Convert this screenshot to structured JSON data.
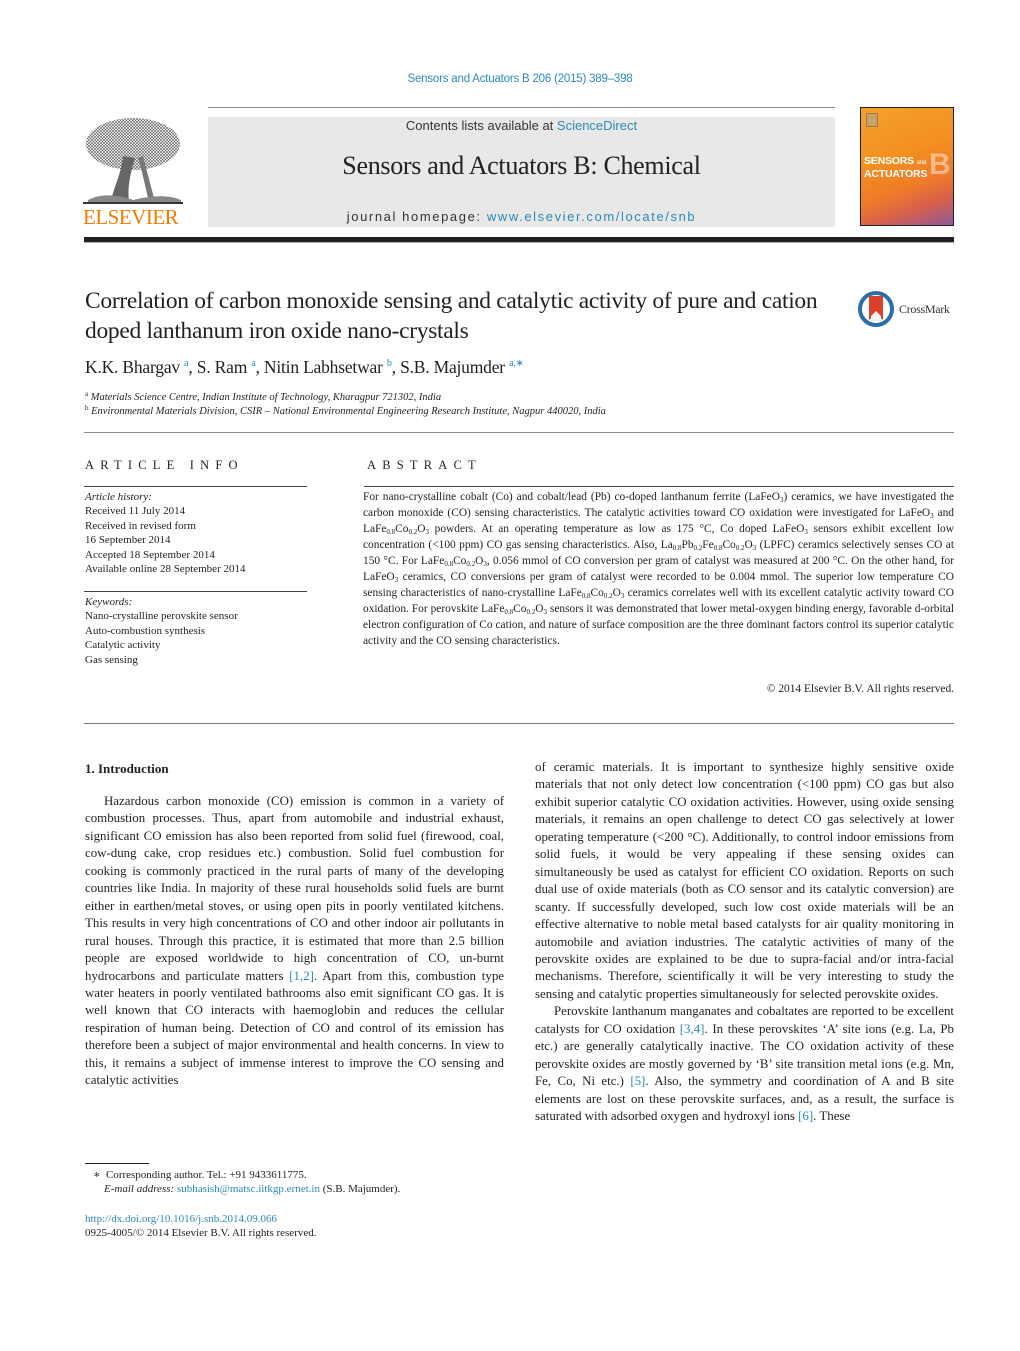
{
  "header": {
    "citation": "Sensors and Actuators B 206 (2015) 389–398",
    "contents_prefix": "Contents lists available at ",
    "contents_link": "ScienceDirect",
    "journal_title": "Sensors and Actuators B: Chemical",
    "homepage_prefix": "journal homepage: ",
    "homepage_link": "www.elsevier.com/locate/snb",
    "publisher_logo_text": "ELSEVIER",
    "cover": {
      "line1": "SENSORS",
      "and": "and",
      "line2": "ACTUATORS",
      "letter": "B"
    },
    "colors": {
      "link": "#2a8ab8",
      "elsevier_orange": "#f07c00",
      "masthead_bg": "#e8e8e8"
    }
  },
  "article": {
    "title": "Correlation of carbon monoxide sensing and catalytic activity of pure and cation doped lanthanum iron oxide nano-crystals",
    "crossmark_label": "CrossMark",
    "authors": [
      {
        "name": "K.K. Bhargav",
        "sup": "a"
      },
      {
        "name": "S. Ram",
        "sup": "a"
      },
      {
        "name": "Nitin Labhsetwar",
        "sup": "b"
      },
      {
        "name": "S.B. Majumder",
        "sup": "a,∗"
      }
    ],
    "affiliations": [
      {
        "sup": "a",
        "text": "Materials Science Centre, Indian Institute of Technology, Kharagpur 721302, India"
      },
      {
        "sup": "b",
        "text": "Environmental Materials Division, CSIR – National Environmental Engineering Research Institute, Nagpur 440020, India"
      }
    ]
  },
  "article_info": {
    "heading": "ARTICLE INFO",
    "history_label": "Article history:",
    "history": [
      "Received 11 July 2014",
      "Received in revised form",
      "16 September 2014",
      "Accepted 18 September 2014",
      "Available online 28 September 2014"
    ],
    "keywords_label": "Keywords:",
    "keywords": [
      "Nano-crystalline perovskite sensor",
      "Auto-combustion synthesis",
      "Catalytic activity",
      "Gas sensing"
    ]
  },
  "abstract": {
    "heading": "ABSTRACT",
    "segments": [
      {
        "t": "For nano-crystalline cobalt (Co) and cobalt/lead (Pb) co-doped lanthanum ferrite (LaFeO"
      },
      {
        "s": "3"
      },
      {
        "t": ") ceramics, we have investigated the carbon monoxide (CO) sensing characteristics. The catalytic activities toward CO oxidation were investigated for LaFeO"
      },
      {
        "s": "3"
      },
      {
        "t": " and LaFe"
      },
      {
        "s": "0.8"
      },
      {
        "t": "Co"
      },
      {
        "s": "0.2"
      },
      {
        "t": "O"
      },
      {
        "s": "3"
      },
      {
        "t": " powders. At an operating temperature as low as 175 °C, Co doped LaFeO"
      },
      {
        "s": "3"
      },
      {
        "t": " sensors exhibit excellent low concentration (<100 ppm) CO gas sensing characteristics. Also, La"
      },
      {
        "s": "0.8"
      },
      {
        "t": "Pb"
      },
      {
        "s": "0.2"
      },
      {
        "t": "Fe"
      },
      {
        "s": "0.8"
      },
      {
        "t": "Co"
      },
      {
        "s": "0.2"
      },
      {
        "t": "O"
      },
      {
        "s": "3"
      },
      {
        "t": " (LPFC) ceramics selectively senses CO at 150 °C. For LaFe"
      },
      {
        "s": "0.8"
      },
      {
        "t": "Co"
      },
      {
        "s": "0.2"
      },
      {
        "t": "O"
      },
      {
        "s": "3"
      },
      {
        "t": ", 0.056 mmol of CO conversion per gram of catalyst was measured at 200 °C. On the other hand, for LaFeO"
      },
      {
        "s": "3"
      },
      {
        "t": " ceramics, CO conversions per gram of catalyst were recorded to be 0.004 mmol. The superior low temperature CO sensing characteristics of nano-crystalline LaFe"
      },
      {
        "s": "0.8"
      },
      {
        "t": "Co"
      },
      {
        "s": "0.2"
      },
      {
        "t": "O"
      },
      {
        "s": "3"
      },
      {
        "t": " ceramics correlates well with its excellent catalytic activity toward CO oxidation. For perovskite LaFe"
      },
      {
        "s": "0.8"
      },
      {
        "t": "Co"
      },
      {
        "s": "0.2"
      },
      {
        "t": "O"
      },
      {
        "s": "3"
      },
      {
        "t": " sensors it was demonstrated that lower metal-oxygen binding energy, favorable d-orbital electron configuration of Co cation, and nature of surface composition are the three dominant factors control its superior catalytic activity and the CO sensing characteristics."
      }
    ],
    "copyright": "© 2014 Elsevier B.V. All rights reserved."
  },
  "body": {
    "section_heading": "1.  Introduction",
    "col1_para1": [
      {
        "t": "Hazardous carbon monoxide (CO) emission is common in a variety of combustion processes. Thus, apart from automobile and industrial exhaust, significant CO emission has also been reported from solid fuel (firewood, coal, cow-dung cake, crop residues etc.) combustion. Solid fuel combustion for cooking is commonly practiced in the rural parts of many of the developing countries like India. In majority of these rural households solid fuels are burnt either in earthen/metal stoves, or using open pits in poorly ventilated kitchens. This results in very high concentrations of CO and other indoor air pollutants in rural houses. Through this practice, it is estimated that more than 2.5 billion people are exposed worldwide to high concentration of CO, un-burnt hydrocarbons and particulate matters "
      },
      {
        "r": "[1,2]"
      },
      {
        "t": ". Apart from this, combustion type water heaters in poorly ventilated bathrooms also emit significant CO gas. It is well known that CO interacts with haemoglobin and reduces the cellular respiration of human being. Detection of CO and control of its emission has therefore been a subject of major environmental and health concerns. In view to this, it remains a subject of immense interest to improve the CO sensing and catalytic activities"
      }
    ],
    "col2_para1": [
      {
        "t": "of ceramic materials. It is important to synthesize highly sensitive oxide materials that not only detect low concentration (<100 ppm) CO gas but also exhibit superior catalytic CO oxidation activities. However, using oxide sensing materials, it remains an open challenge to detect CO gas selectively at lower operating temperature (<200 °C). Additionally, to control indoor emissions from solid fuels, it would be very appealing if these sensing oxides can simultaneously be used as catalyst for efficient CO oxidation. Reports on such dual use of oxide materials (both as CO sensor and its catalytic conversion) are scanty. If successfully developed, such low cost oxide materials will be an effective alternative to noble metal based catalysts for air quality monitoring in automobile and aviation industries. The catalytic activities of many of the perovskite oxides are explained to be due to supra-facial and/or intra-facial mechanisms. Therefore, scientifically it will be very interesting to study the sensing and catalytic properties simultaneously for selected perovskite oxides."
      }
    ],
    "col2_para2": [
      {
        "t": "Perovskite lanthanum manganates and cobaltates are reported to be excellent catalysts for CO oxidation "
      },
      {
        "r": "[3,4]"
      },
      {
        "t": ". In these perovskites ‘A’ site ions (e.g. La, Pb etc.) are generally catalytically inactive. The CO oxidation activity of these perovskite oxides are mostly governed by ‘B’ site transition metal ions (e.g. Mn, Fe, Co, Ni etc.) "
      },
      {
        "r": "[5]"
      },
      {
        "t": ". Also, the symmetry and coordination of A and B site elements are lost on these perovskite surfaces, and, as a result, the surface is saturated with adsorbed oxygen and hydroxyl ions "
      },
      {
        "r": "[6]"
      },
      {
        "t": ". These"
      }
    ]
  },
  "footnote": {
    "marker": "∗",
    "corresponding": "Corresponding author. Tel.: +91 9433611775.",
    "email_label": "E-mail address: ",
    "email": "subhasish@matsc.iitkgp.ernet.in",
    "email_suffix": " (S.B. Majumder)."
  },
  "doi": {
    "url": "http://dx.doi.org/10.1016/j.snb.2014.09.066",
    "issn_line": "0925-4005/© 2014 Elsevier B.V. All rights reserved."
  }
}
